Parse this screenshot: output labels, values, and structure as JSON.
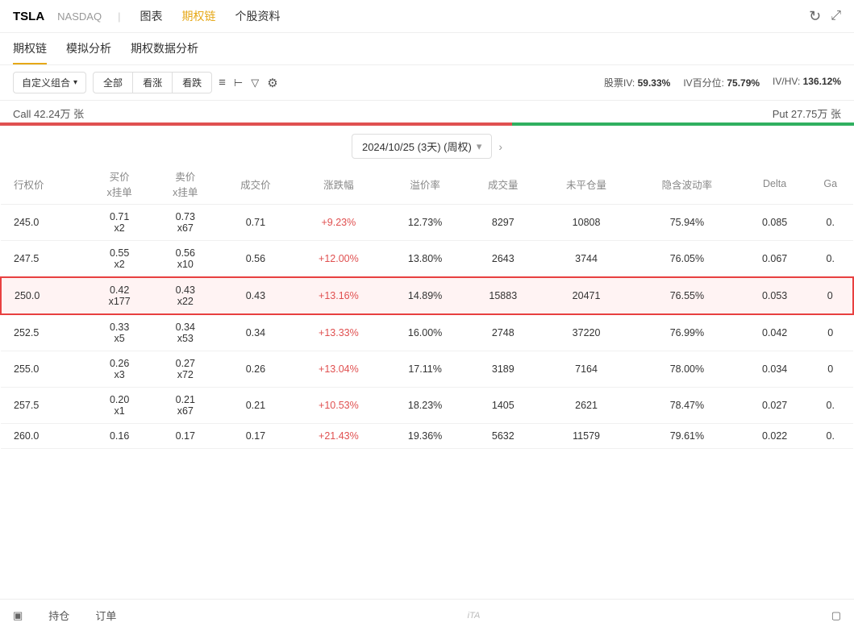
{
  "topNav": {
    "ticker": "TSLA",
    "exchange": "NASDAQ",
    "divider": "|",
    "tabs": [
      "图表",
      "期权链",
      "个股资料"
    ],
    "activeTab": "期权链",
    "refreshIcon": "↻",
    "expandIcon": "⤢"
  },
  "subNav": {
    "tabs": [
      "期权链",
      "模拟分析",
      "期权数据分析"
    ],
    "activeTab": "期权链"
  },
  "toolbar": {
    "customGroup": "自定义组合",
    "filterAll": "全部",
    "filterCall": "看涨",
    "filterPut": "看跌",
    "icons": [
      "≡",
      "⊢",
      "⊤",
      "⚙"
    ],
    "ivLabel": "股票IV:",
    "ivValue": "59.33%",
    "ivPercentileLabel": "IV百分位:",
    "ivPercentileValue": "75.79%",
    "ivhvLabel": "IV/HV:",
    "ivhvValue": "136.12%"
  },
  "callput": {
    "callLabel": "Call 42.24万 张",
    "putLabel": "Put 27.75万 张",
    "callPercent": 60,
    "putPercent": 40
  },
  "dateSelector": {
    "date": "2024/10/25 (3天) (周权)",
    "nextArrow": "›"
  },
  "tableHeaders": [
    "行权价",
    "买价\nx挂单",
    "卖价\nx挂单",
    "成交价",
    "涨跌幅",
    "溢价率",
    "成交量",
    "未平仓量",
    "隐含波动率",
    "Delta",
    "Ga"
  ],
  "rows": [
    {
      "strike": "245.0",
      "bid": "0.71\nx2",
      "ask": "0.73\nx67",
      "price": "0.71",
      "change": "+9.23%",
      "premium": "12.73%",
      "volume": "8297",
      "openInterest": "10808",
      "iv": "75.94%",
      "delta": "0.085",
      "gamma": "0.",
      "highlighted": false
    },
    {
      "strike": "247.5",
      "bid": "0.55\nx2",
      "ask": "0.56\nx10",
      "price": "0.56",
      "change": "+12.00%",
      "premium": "13.80%",
      "volume": "2643",
      "openInterest": "3744",
      "iv": "76.05%",
      "delta": "0.067",
      "gamma": "0.",
      "highlighted": false
    },
    {
      "strike": "250.0",
      "bid": "0.42\nx177",
      "ask": "0.43\nx22",
      "price": "0.43",
      "change": "+13.16%",
      "premium": "14.89%",
      "volume": "15883",
      "openInterest": "20471",
      "iv": "76.55%",
      "delta": "0.053",
      "gamma": "0",
      "highlighted": true
    },
    {
      "strike": "252.5",
      "bid": "0.33\nx5",
      "ask": "0.34\nx53",
      "price": "0.34",
      "change": "+13.33%",
      "premium": "16.00%",
      "volume": "2748",
      "openInterest": "37220",
      "iv": "76.99%",
      "delta": "0.042",
      "gamma": "0",
      "highlighted": false
    },
    {
      "strike": "255.0",
      "bid": "0.26\nx3",
      "ask": "0.27\nx72",
      "price": "0.26",
      "change": "+13.04%",
      "premium": "17.11%",
      "volume": "3189",
      "openInterest": "7164",
      "iv": "78.00%",
      "delta": "0.034",
      "gamma": "0",
      "highlighted": false
    },
    {
      "strike": "257.5",
      "bid": "0.20\nx1",
      "ask": "0.21\nx67",
      "price": "0.21",
      "change": "+10.53%",
      "premium": "18.23%",
      "volume": "1405",
      "openInterest": "2621",
      "iv": "78.47%",
      "delta": "0.027",
      "gamma": "0.",
      "highlighted": false
    },
    {
      "strike": "260.0",
      "bid": "0.16",
      "ask": "0.17",
      "price": "0.17",
      "change": "+21.43%",
      "premium": "19.36%",
      "volume": "5632",
      "openInterest": "11579",
      "iv": "79.61%",
      "delta": "0.022",
      "gamma": "0.",
      "highlighted": false
    }
  ],
  "bottomBar": {
    "holdingLabel": "持仓",
    "orderLabel": "订单",
    "leftIcon": "▣",
    "rightIcon": "▢",
    "watermark": "iTA"
  }
}
